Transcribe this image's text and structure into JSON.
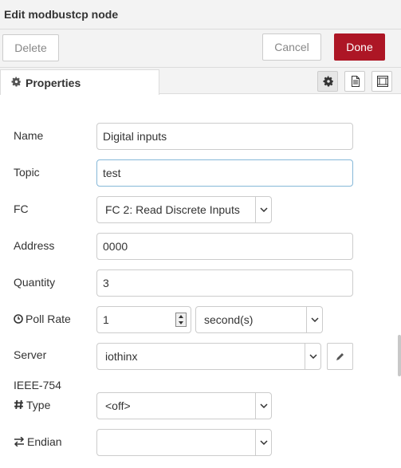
{
  "header": {
    "title": "Edit modbustcp node"
  },
  "buttons": {
    "delete": "Delete",
    "cancel": "Cancel",
    "done": "Done"
  },
  "tabs": {
    "properties": "Properties",
    "icons": [
      "gear-icon",
      "description-icon",
      "appearance-icon"
    ]
  },
  "form": {
    "name": {
      "label": "Name",
      "value": "Digital inputs"
    },
    "topic": {
      "label": "Topic",
      "value": "test"
    },
    "fc": {
      "label": "FC",
      "value": "FC 2: Read Discrete Inputs"
    },
    "address": {
      "label": "Address",
      "value": "0000"
    },
    "quantity": {
      "label": "Quantity",
      "value": "3"
    },
    "poll_rate": {
      "label": "Poll Rate",
      "value": "1",
      "unit": "second(s)"
    },
    "server": {
      "label": "Server",
      "value": "iothinx"
    },
    "ieee754": {
      "label": "IEEE-754"
    },
    "type": {
      "label": "Type",
      "value": "<off>"
    },
    "endian": {
      "label": "Endian",
      "value": ""
    }
  },
  "colors": {
    "done_bg": "#ad1625",
    "focus_border": "#86b8d8",
    "panel_bg": "#f3f3f3"
  }
}
